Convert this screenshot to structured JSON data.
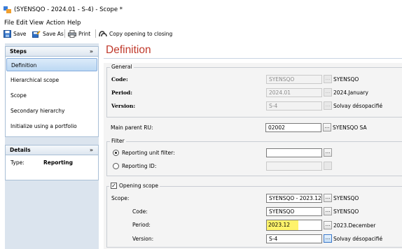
{
  "window": {
    "title": "(SYENSQO - 2024.01 - S-4) - Scope *"
  },
  "menu": [
    "File",
    "Edit",
    "View",
    "Action",
    "Help"
  ],
  "toolbar": {
    "save": "Save",
    "save_as": "Save As",
    "print": "Print",
    "copy_opening": "Copy opening to closing"
  },
  "steps_panel": {
    "title": "Steps",
    "items": [
      "Definition",
      "Hierarchical scope",
      "Scope",
      "Secondary hierarchy",
      "Initialize using a portfolio"
    ]
  },
  "details_panel": {
    "title": "Details",
    "type_label": "Type:",
    "type_value": "Reporting"
  },
  "heading": "Definition",
  "general": {
    "title": "General",
    "code_label": "Code:",
    "code_value": "SYENSQO",
    "code_desc": "SYENSQO",
    "period_label": "Period:",
    "period_value": "2024.01",
    "period_desc": "2024.January",
    "version_label": "Version:",
    "version_value": "S-4",
    "version_desc": "Solvay désopacifié"
  },
  "main_parent": {
    "label": "Main parent RU:",
    "value": "02002",
    "desc": "SYENSQO SA"
  },
  "filter": {
    "title": "Filter",
    "reporting_unit_filter": "Reporting unit filter:",
    "reporting_id": "Reporting ID:"
  },
  "opening_scope": {
    "title": "Opening scope",
    "scope_label": "Scope:",
    "scope_value": "SYENSQO - 2023.12 -",
    "scope_desc": "SYENSQO",
    "code_label": "Code:",
    "code_value": "SYENSQO",
    "code_desc": "SYENSQO",
    "period_label": "Period:",
    "period_value": "2023.12",
    "period_desc": "2023.December",
    "version_label": "Version:",
    "version_value": "S-4",
    "version_desc": "Solvay désopacifié"
  },
  "ellipsis": "...",
  "colors": {
    "heading": "#c0392b",
    "highlight": "#fff36b",
    "panel": "#dbe4ee"
  }
}
